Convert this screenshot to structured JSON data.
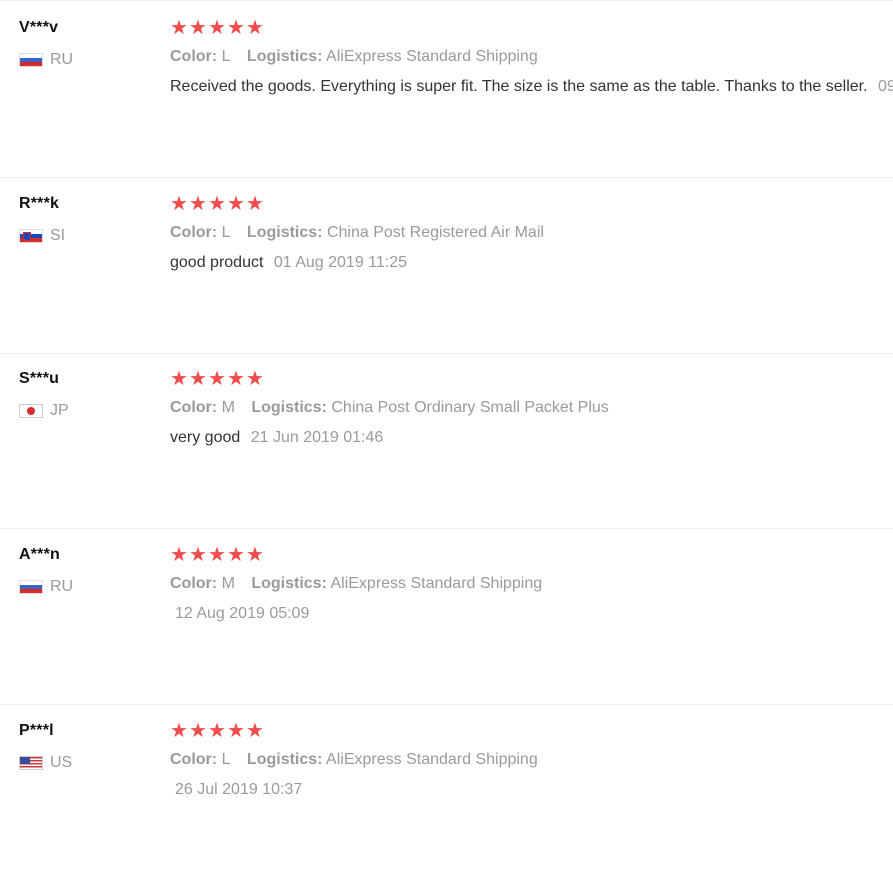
{
  "reviews": [
    {
      "name": "V***v",
      "country": "RU",
      "flag": "ru",
      "rating": 5,
      "color_label": "Color:",
      "color": "L",
      "logistics_label": "Logistics:",
      "logistics": "AliExpress Standard Shipping",
      "text": "Received the goods. Everything is super fit. The size is the same as the table. Thanks to the seller.",
      "date": "09"
    },
    {
      "name": "R***k",
      "country": "SI",
      "flag": "si",
      "rating": 5,
      "color_label": "Color:",
      "color": "L",
      "logistics_label": "Logistics:",
      "logistics": "China Post Registered Air Mail",
      "text": "good product",
      "date": "01 Aug 2019 11:25"
    },
    {
      "name": "S***u",
      "country": "JP",
      "flag": "jp",
      "rating": 5,
      "color_label": "Color:",
      "color": "M",
      "logistics_label": "Logistics:",
      "logistics": "China Post Ordinary Small Packet Plus",
      "text": "very good",
      "date": "21 Jun 2019 01:46"
    },
    {
      "name": "A***n",
      "country": "RU",
      "flag": "ru",
      "rating": 5,
      "color_label": "Color:",
      "color": "M",
      "logistics_label": "Logistics:",
      "logistics": "AliExpress Standard Shipping",
      "text": "",
      "date": "12 Aug 2019 05:09"
    },
    {
      "name": "P***l",
      "country": "US",
      "flag": "us",
      "rating": 5,
      "color_label": "Color:",
      "color": "L",
      "logistics_label": "Logistics:",
      "logistics": "AliExpress Standard Shipping",
      "text": "",
      "date": "26 Jul 2019 10:37"
    }
  ],
  "colors": {
    "star": "#f04c4c",
    "muted": "#9a9a9a",
    "divider": "#ececec"
  }
}
